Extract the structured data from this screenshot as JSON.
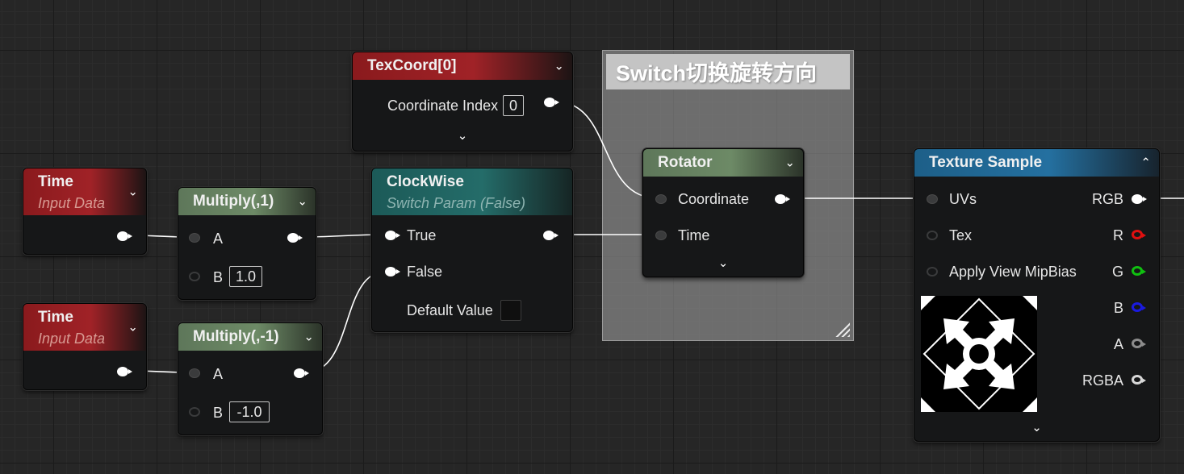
{
  "comment": {
    "title": "Switch切换旋转方向"
  },
  "nodes": {
    "texcoord": {
      "title": "TexCoord[0]",
      "coordinate_index_label": "Coordinate Index",
      "coordinate_index_value": "0"
    },
    "time1": {
      "title": "Time",
      "subtitle": "Input Data"
    },
    "time2": {
      "title": "Time",
      "subtitle": "Input Data"
    },
    "multiply1": {
      "title": "Multiply(,1)",
      "pin_a": "A",
      "pin_b": "B",
      "b_value": "1.0"
    },
    "multiply2": {
      "title": "Multiply(,-1)",
      "pin_a": "A",
      "pin_b": "B",
      "b_value": "-1.0"
    },
    "clockwise": {
      "title": "ClockWise",
      "subtitle": "Switch Param (False)",
      "pin_true": "True",
      "pin_false": "False",
      "default_value_label": "Default Value"
    },
    "rotator": {
      "title": "Rotator",
      "pin_coordinate": "Coordinate",
      "pin_time": "Time"
    },
    "texture_sample": {
      "title": "Texture Sample",
      "inputs": [
        "UVs",
        "Tex",
        "Apply View MipBias"
      ],
      "outputs": [
        "RGB",
        "R",
        "G",
        "B",
        "A",
        "RGBA"
      ]
    }
  },
  "pin_colors": {
    "R": "#e01010",
    "G": "#10c010",
    "B": "#1a1ae0",
    "A": "#8c8c8c",
    "RGBA": "#d8d8d8"
  },
  "icons": {
    "collapse": "chevron-down-icon",
    "expand": "chevron-up-icon",
    "resize": "resize-grip-icon"
  }
}
